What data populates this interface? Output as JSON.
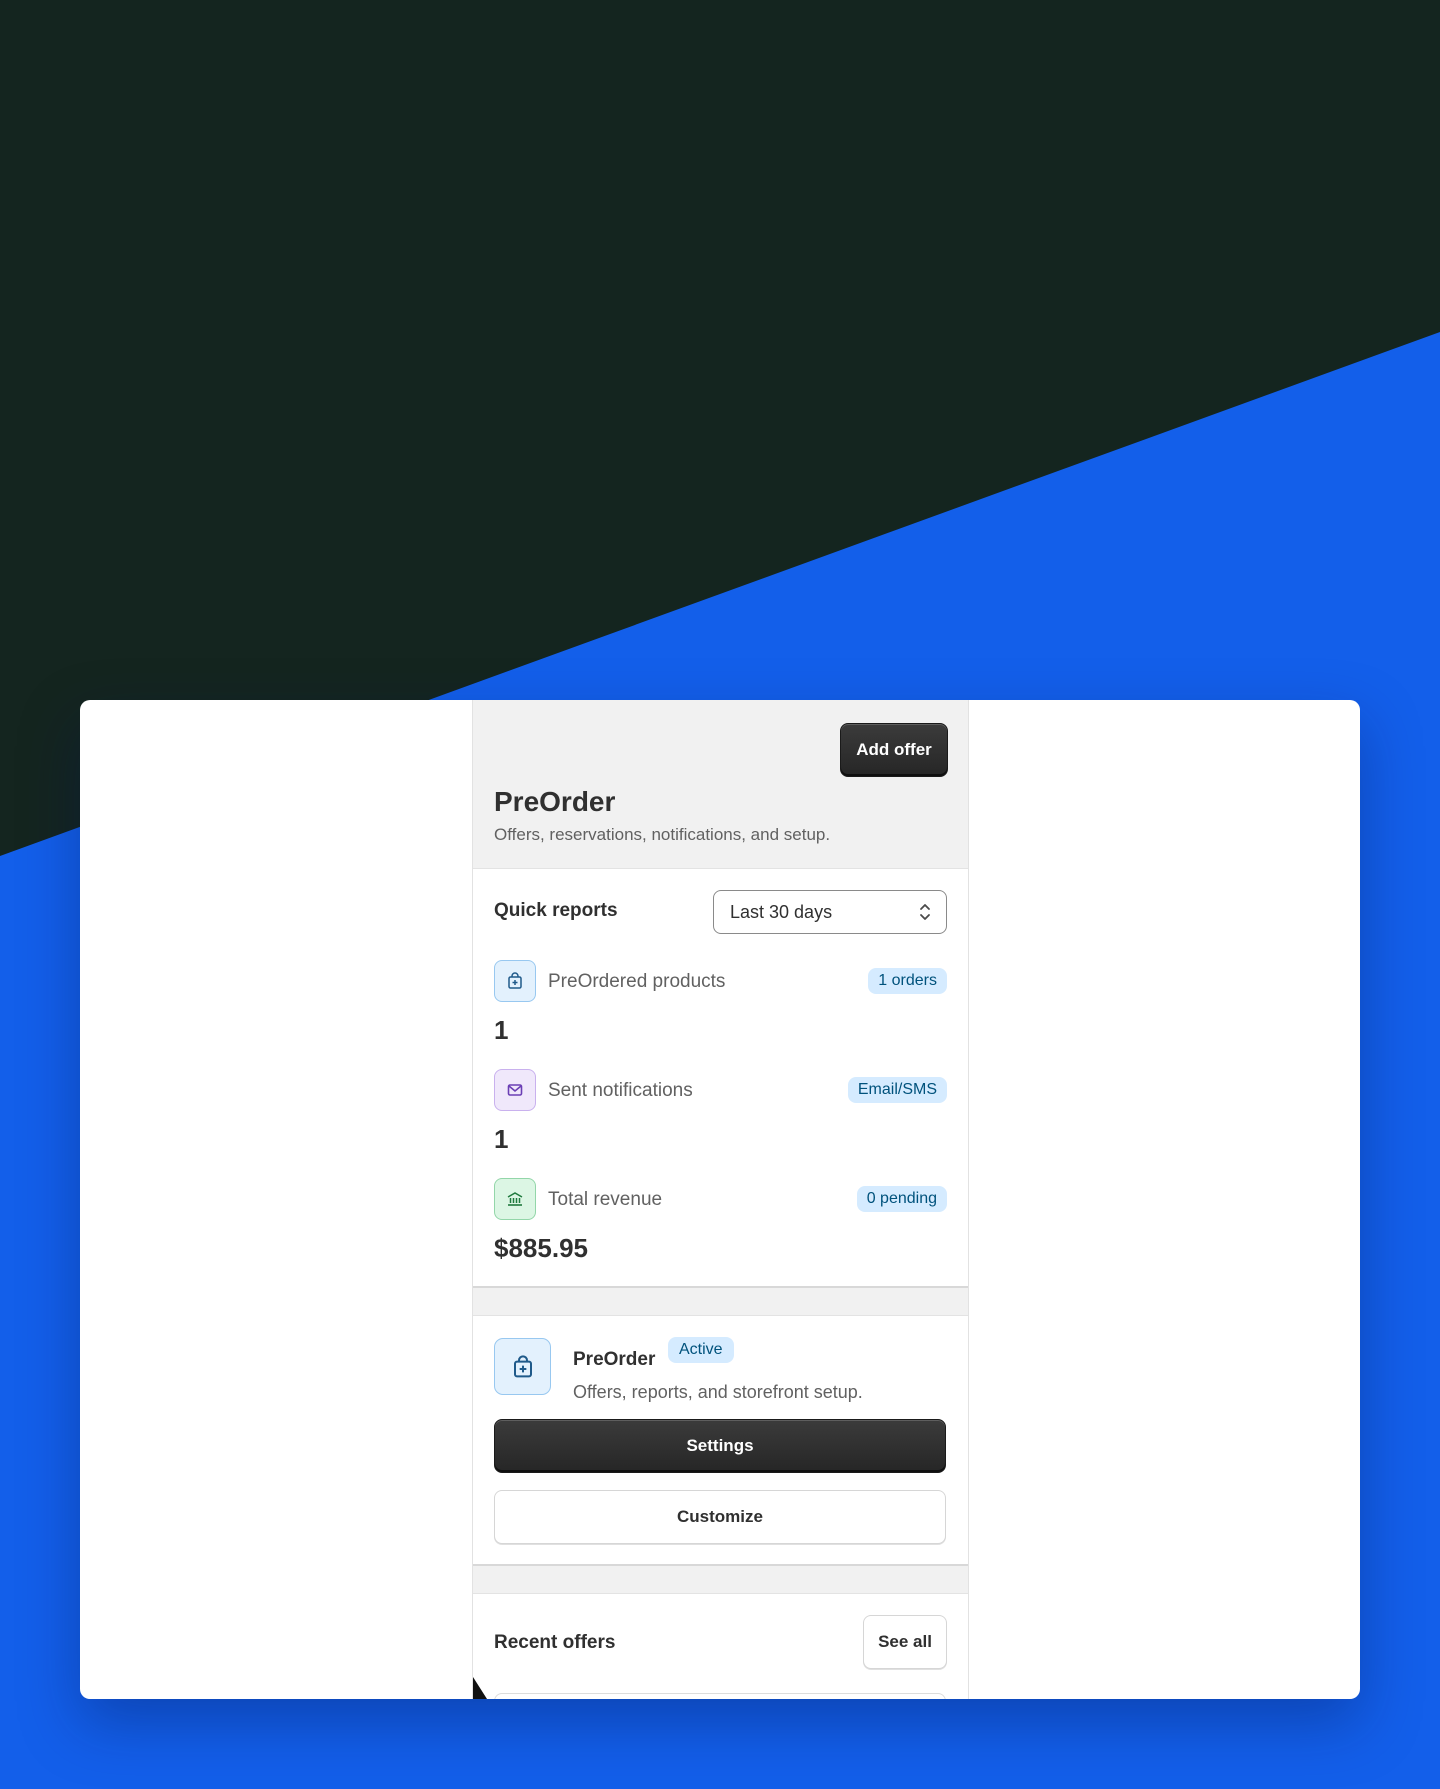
{
  "colors": {
    "background_dark": "#14251f",
    "background_blue": "#135fea",
    "button_dark": "#303030",
    "badge_bg": "#d5ebff",
    "badge_text": "#00527c"
  },
  "header": {
    "add_offer_label": "Add offer",
    "title": "PreOrder",
    "subtitle": "Offers, reservations, notifications, and setup."
  },
  "quick_reports": {
    "title": "Quick reports",
    "range_selected": "Last 30 days",
    "metrics": [
      {
        "icon": "bag-icon",
        "label": "PreOrdered products",
        "badge": "1 orders",
        "value": "1"
      },
      {
        "icon": "mail-icon",
        "label": "Sent notifications",
        "badge": "Email/SMS",
        "value": "1"
      },
      {
        "icon": "bank-icon",
        "label": "Total revenue",
        "badge": "0 pending",
        "value": "$885.95"
      }
    ]
  },
  "app_card": {
    "icon": "bag-icon",
    "name": "PreOrder",
    "status": "Active",
    "description": "Offers, reports, and storefront setup.",
    "settings_label": "Settings",
    "customize_label": "Customize"
  },
  "recent_offers": {
    "title": "Recent offers",
    "see_all_label": "See all"
  }
}
